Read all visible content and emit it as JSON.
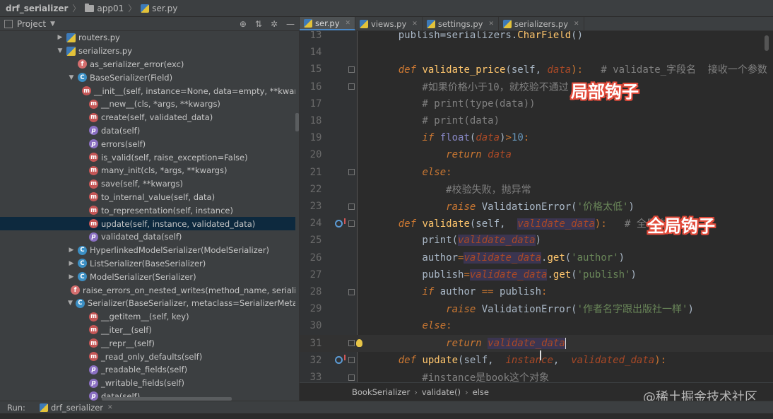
{
  "breadcrumb": {
    "project": "drf_serializer",
    "folder": "app01",
    "file": "ser.py"
  },
  "project_panel": {
    "title": "Project",
    "header_icons": [
      "target-icon",
      "collapse-icon",
      "gear-icon",
      "hide-icon"
    ],
    "header_glyphs": {
      "target": "⊕",
      "collapse": "⇅",
      "gear": "✲",
      "hide": "—"
    },
    "tree": [
      {
        "indent": 80,
        "arrow": "▶",
        "badge": "py",
        "badge_text": "",
        "label": "routers.py",
        "selected": false
      },
      {
        "indent": 80,
        "arrow": "▼",
        "badge": "py",
        "badge_text": "",
        "label": "serializers.py",
        "selected": false
      },
      {
        "indent": 96,
        "arrow": "",
        "badge": "f",
        "badge_text": "f",
        "label": "as_serializer_error(exc)",
        "selected": false
      },
      {
        "indent": 96,
        "arrow": "▼",
        "badge": "c",
        "badge_text": "C",
        "label": "BaseSerializer(Field)",
        "selected": false
      },
      {
        "indent": 112,
        "arrow": "",
        "badge": "m",
        "badge_text": "m",
        "label": "__init__(self, instance=None, data=empty, **kwargs)",
        "selected": false
      },
      {
        "indent": 112,
        "arrow": "",
        "badge": "m",
        "badge_text": "m",
        "label": "__new__(cls, *args, **kwargs)",
        "selected": false
      },
      {
        "indent": 112,
        "arrow": "",
        "badge": "m",
        "badge_text": "m",
        "label": "create(self, validated_data)",
        "selected": false
      },
      {
        "indent": 112,
        "arrow": "",
        "badge": "p",
        "badge_text": "p",
        "label": "data(self)",
        "selected": false
      },
      {
        "indent": 112,
        "arrow": "",
        "badge": "p",
        "badge_text": "p",
        "label": "errors(self)",
        "selected": false
      },
      {
        "indent": 112,
        "arrow": "",
        "badge": "m",
        "badge_text": "m",
        "label": "is_valid(self, raise_exception=False)",
        "selected": false
      },
      {
        "indent": 112,
        "arrow": "",
        "badge": "m",
        "badge_text": "m",
        "label": "many_init(cls, *args, **kwargs)",
        "selected": false
      },
      {
        "indent": 112,
        "arrow": "",
        "badge": "m",
        "badge_text": "m",
        "label": "save(self, **kwargs)",
        "selected": false
      },
      {
        "indent": 112,
        "arrow": "",
        "badge": "m",
        "badge_text": "m",
        "label": "to_internal_value(self, data)",
        "selected": false
      },
      {
        "indent": 112,
        "arrow": "",
        "badge": "m",
        "badge_text": "m",
        "label": "to_representation(self, instance)",
        "selected": false
      },
      {
        "indent": 112,
        "arrow": "",
        "badge": "m",
        "badge_text": "m",
        "label": "update(self, instance, validated_data)",
        "selected": true
      },
      {
        "indent": 112,
        "arrow": "",
        "badge": "p",
        "badge_text": "p",
        "label": "validated_data(self)",
        "selected": false
      },
      {
        "indent": 96,
        "arrow": "▶",
        "badge": "c",
        "badge_text": "C",
        "label": "HyperlinkedModelSerializer(ModelSerializer)",
        "selected": false
      },
      {
        "indent": 96,
        "arrow": "▶",
        "badge": "c",
        "badge_text": "C",
        "label": "ListSerializer(BaseSerializer)",
        "selected": false
      },
      {
        "indent": 96,
        "arrow": "▶",
        "badge": "c",
        "badge_text": "C",
        "label": "ModelSerializer(Serializer)",
        "selected": false
      },
      {
        "indent": 96,
        "arrow": "",
        "badge": "f",
        "badge_text": "f",
        "label": "raise_errors_on_nested_writes(method_name, serializer, v",
        "selected": false
      },
      {
        "indent": 96,
        "arrow": "▼",
        "badge": "c",
        "badge_text": "C",
        "label": "Serializer(BaseSerializer, metaclass=SerializerMetaclass)",
        "selected": false
      },
      {
        "indent": 112,
        "arrow": "",
        "badge": "m",
        "badge_text": "m",
        "label": "__getitem__(self, key)",
        "selected": false
      },
      {
        "indent": 112,
        "arrow": "",
        "badge": "m",
        "badge_text": "m",
        "label": "__iter__(self)",
        "selected": false
      },
      {
        "indent": 112,
        "arrow": "",
        "badge": "m",
        "badge_text": "m",
        "label": "__repr__(self)",
        "selected": false
      },
      {
        "indent": 112,
        "arrow": "",
        "badge": "m",
        "badge_text": "m",
        "label": "_read_only_defaults(self)",
        "selected": false
      },
      {
        "indent": 112,
        "arrow": "",
        "badge": "p",
        "badge_text": "p",
        "label": "_readable_fields(self)",
        "selected": false
      },
      {
        "indent": 112,
        "arrow": "",
        "badge": "p",
        "badge_text": "p",
        "label": "_writable_fields(self)",
        "selected": false
      },
      {
        "indent": 112,
        "arrow": "",
        "badge": "p",
        "badge_text": "p",
        "label": "data(self)",
        "selected": false
      }
    ]
  },
  "editor": {
    "tabs": [
      {
        "label": "ser.py",
        "active": true
      },
      {
        "label": "views.py",
        "active": false
      },
      {
        "label": "settings.py",
        "active": false
      },
      {
        "label": "serializers.py",
        "active": false
      }
    ],
    "tab_close_glyph": "✕",
    "lines": [
      {
        "no": "13",
        "marker": "",
        "fold": false,
        "current": false,
        "tokens": [
          [
            "",
            "    publish=serializers."
          ],
          [
            "fn",
            "CharField"
          ],
          [
            "",
            "()"
          ]
        ]
      },
      {
        "no": "14",
        "marker": "",
        "fold": false,
        "current": false,
        "tokens": []
      },
      {
        "no": "15",
        "marker": "",
        "fold": true,
        "current": false,
        "tokens": [
          [
            "",
            "    "
          ],
          [
            "kwi",
            "def "
          ],
          [
            "fn",
            "validate_price"
          ],
          [
            "",
            "(self, "
          ],
          [
            "pm",
            "data"
          ],
          [
            "op",
            "):"
          ],
          [
            "cm",
            "   # validate_字段名  接收一个参数"
          ]
        ]
      },
      {
        "no": "16",
        "marker": "",
        "fold": true,
        "current": false,
        "tokens": [
          [
            "cm",
            "        #如果价格小于10，就校验不通过"
          ]
        ]
      },
      {
        "no": "17",
        "marker": "",
        "fold": false,
        "current": false,
        "tokens": [
          [
            "cm",
            "        # print(type(data))"
          ]
        ]
      },
      {
        "no": "18",
        "marker": "",
        "fold": false,
        "current": false,
        "tokens": [
          [
            "cm",
            "        # print(data)"
          ]
        ]
      },
      {
        "no": "19",
        "marker": "",
        "fold": false,
        "current": false,
        "tokens": [
          [
            "",
            "        "
          ],
          [
            "kwi",
            "if "
          ],
          [
            "cls",
            "float"
          ],
          [
            "",
            "("
          ],
          [
            "pm",
            "data"
          ],
          [
            "",
            ")"
          ],
          [
            "op",
            ">"
          ],
          [
            "nm",
            "10"
          ],
          [
            "op",
            ":"
          ]
        ]
      },
      {
        "no": "20",
        "marker": "",
        "fold": false,
        "current": false,
        "tokens": [
          [
            "",
            "            "
          ],
          [
            "kwi",
            "return "
          ],
          [
            "pm",
            "data"
          ]
        ]
      },
      {
        "no": "21",
        "marker": "",
        "fold": true,
        "current": false,
        "tokens": [
          [
            "",
            "        "
          ],
          [
            "kwi",
            "else"
          ],
          [
            "op",
            ":"
          ]
        ]
      },
      {
        "no": "22",
        "marker": "",
        "fold": false,
        "current": false,
        "tokens": [
          [
            "cm",
            "            #校验失败，抛异常"
          ]
        ]
      },
      {
        "no": "23",
        "marker": "",
        "fold": true,
        "current": false,
        "tokens": [
          [
            "",
            "            "
          ],
          [
            "kwi",
            "raise "
          ],
          [
            "",
            "ValidationError("
          ],
          [
            "st",
            "'价格太低'"
          ],
          [
            "",
            ")"
          ]
        ]
      },
      {
        "no": "24",
        "marker": "override",
        "fold": true,
        "current": false,
        "tokens": [
          [
            "",
            "    "
          ],
          [
            "kwi",
            "def "
          ],
          [
            "fn",
            "validate"
          ],
          [
            "",
            "(self,  "
          ],
          [
            "pmh",
            "validate_data"
          ],
          [
            "op",
            "):"
          ],
          [
            "cm",
            "   # 全局钩子"
          ]
        ]
      },
      {
        "no": "25",
        "marker": "",
        "fold": false,
        "current": false,
        "tokens": [
          [
            "",
            "        print("
          ],
          [
            "pmh",
            "validate_data"
          ],
          [
            "",
            ")"
          ]
        ]
      },
      {
        "no": "26",
        "marker": "",
        "fold": false,
        "current": false,
        "tokens": [
          [
            "",
            "        author"
          ],
          [
            "op",
            "="
          ],
          [
            "pmh",
            "validate_data"
          ],
          [
            "",
            "."
          ],
          [
            "fn",
            "get"
          ],
          [
            "",
            "("
          ],
          [
            "st",
            "'author'"
          ],
          [
            "",
            ")"
          ]
        ]
      },
      {
        "no": "27",
        "marker": "",
        "fold": false,
        "current": false,
        "tokens": [
          [
            "",
            "        publish"
          ],
          [
            "op",
            "="
          ],
          [
            "pmh",
            "validate_data"
          ],
          [
            "",
            "."
          ],
          [
            "fn",
            "get"
          ],
          [
            "",
            "("
          ],
          [
            "st",
            "'publish'"
          ],
          [
            "",
            ")"
          ]
        ]
      },
      {
        "no": "28",
        "marker": "",
        "fold": true,
        "current": false,
        "tokens": [
          [
            "",
            "        "
          ],
          [
            "kwi",
            "if "
          ],
          [
            "",
            "author "
          ],
          [
            "op",
            "=="
          ],
          [
            "",
            " publish"
          ],
          [
            "op",
            ":"
          ]
        ]
      },
      {
        "no": "29",
        "marker": "",
        "fold": false,
        "current": false,
        "tokens": [
          [
            "",
            "            "
          ],
          [
            "kwi",
            "raise "
          ],
          [
            "",
            "ValidationError("
          ],
          [
            "st",
            "'作者名字跟出版社一样'"
          ],
          [
            "",
            ")"
          ]
        ]
      },
      {
        "no": "30",
        "marker": "",
        "fold": false,
        "current": false,
        "tokens": [
          [
            "",
            "        "
          ],
          [
            "kwi",
            "else"
          ],
          [
            "op",
            ":"
          ]
        ]
      },
      {
        "no": "31",
        "marker": "bulb",
        "fold": true,
        "current": true,
        "tokens": [
          [
            "",
            "            "
          ],
          [
            "kwi",
            "return "
          ],
          [
            "pmh",
            "validate_data"
          ],
          [
            "caret",
            ""
          ]
        ]
      },
      {
        "no": "32",
        "marker": "override",
        "fold": true,
        "current": false,
        "tokens": [
          [
            "",
            "    "
          ],
          [
            "kwi",
            "def "
          ],
          [
            "fn",
            "update"
          ],
          [
            "",
            "(self,  "
          ],
          [
            "pm",
            "instance"
          ],
          [
            "",
            ",  "
          ],
          [
            "pm",
            "validated_data"
          ],
          [
            "op",
            "):"
          ]
        ]
      },
      {
        "no": "33",
        "marker": "",
        "fold": true,
        "current": false,
        "tokens": [
          [
            "cm",
            "        #instance是book这个对象"
          ]
        ]
      }
    ],
    "annotations": {
      "local_hook": "局部钩子",
      "global_hook": "全局钩子"
    },
    "crumbs": [
      "BookSerializer",
      "validate()",
      "else"
    ],
    "crumb_sep": "›"
  },
  "watermark": "@稀土掘金技术社区",
  "run_bar": {
    "label": "Run:",
    "config": "drf_serializer",
    "close_glyph": "✕"
  },
  "colors": {
    "keyword": "#cc7832",
    "function": "#ffc66d",
    "parameter": "#aa4926",
    "comment": "#808080",
    "string": "#6a8759",
    "number": "#6897bb",
    "selection": "#0d293e",
    "annotation_outline": "#e24b3b"
  }
}
